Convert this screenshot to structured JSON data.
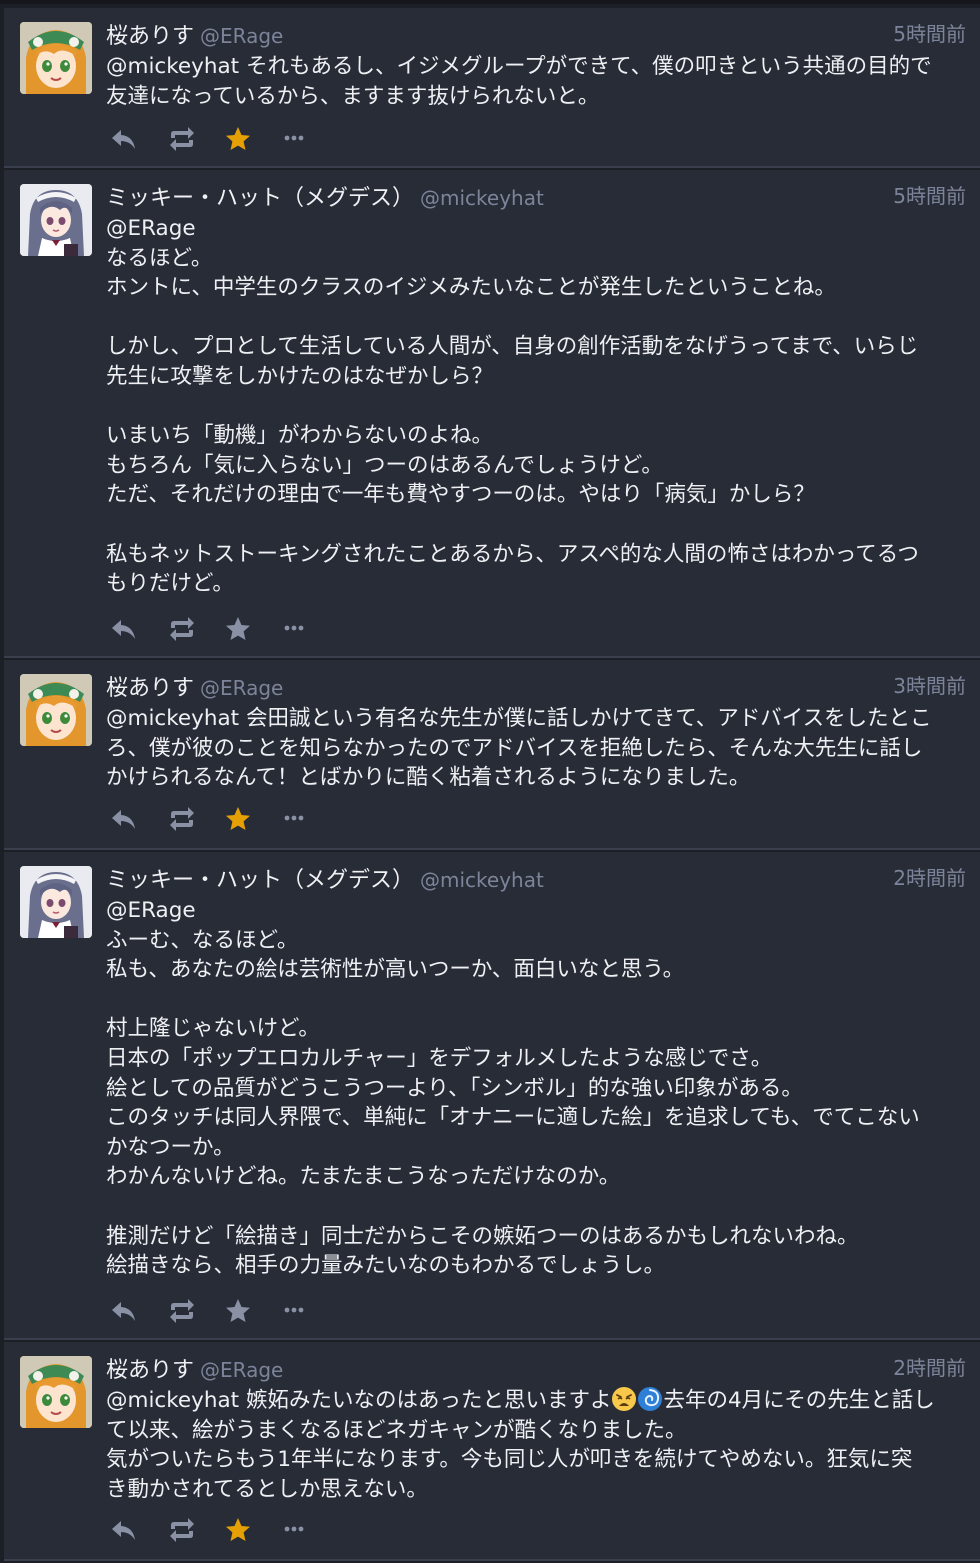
{
  "colors": {
    "background": "#1c1f26",
    "card": "#282c37",
    "muted": "#7d8499",
    "text": "#eef0f3",
    "favourite_active": "#e5a005",
    "icon": "#8a91a5"
  },
  "statuses": [
    {
      "display_name": "桜ありす",
      "acct": "@ERage",
      "time": "5時間前",
      "avatar": "avatar-alice",
      "favourited": true,
      "content": "@mickeyhat それもあるし、イジメグループができて、僕の叩きという共通の目的で\n友達になっているから、ますます抜けられないと。"
    },
    {
      "display_name": "ミッキー・ハット（メグデス）",
      "acct": "@mickeyhat",
      "time": "5時間前",
      "avatar": "avatar-mickey",
      "favourited": false,
      "content": "@ERage\nなるほど。\nホントに、中学生のクラスのイジメみたいなことが発生したということね。\n\nしかし、プロとして生活している人間が、自身の創作活動をなげうってまで、いらじ\n先生に攻撃をしかけたのはなぜかしら？\n\nいまいち「動機」がわからないのよね。\nもちろん「気に入らない」つーのはあるんでしょうけど。\nただ、それだけの理由で一年も費やすつーのは。やはり「病気」かしら？\n\n私もネットストーキングされたことあるから、アスペ的な人間の怖さはわかってるつ\nもりだけど。"
    },
    {
      "display_name": "桜ありす",
      "acct": "@ERage",
      "time": "3時間前",
      "avatar": "avatar-alice",
      "favourited": true,
      "content": "@mickeyhat 会田誠という有名な先生が僕に話しかけてきて、アドバイスをしたとこ\nろ、僕が彼のことを知らなかったのでアドバイスを拒絶したら、そんな大先生に話し\nかけられるなんて！とばかりに酷く粘着されるようになりました。"
    },
    {
      "display_name": "ミッキー・ハット（メグデス）",
      "acct": "@mickeyhat",
      "time": "2時間前",
      "avatar": "avatar-mickey",
      "favourited": false,
      "content": "@ERage\nふーむ、なるほど。\n私も、あなたの絵は芸術性が高いつーか、面白いなと思う。\n\n村上隆じゃないけど。\n日本の「ポップエロカルチャー」をデフォルメしたような感じでさ。\n絵としての品質がどうこうつーより、「シンボル」的な強い印象がある。\nこのタッチは同人界隈で、単純に「オナニーに適した絵」を追求しても、でてこない\nかなつーか。\nわかんないけどね。たまたまこうなっただけなのか。\n\n推測だけど「絵描き」同士だからこその嫉妬つーのはあるかもしれないわね。\n絵描きなら、相手の力量みたいなのもわかるでしょうし。"
    },
    {
      "display_name": "桜ありす",
      "acct": "@ERage",
      "time": "2時間前",
      "avatar": "avatar-alice",
      "favourited": true,
      "content_before_emoji": "@mickeyhat 嫉妬みたいなのはあったと思いますよ",
      "emojis": [
        "weary-face-emoji",
        "cyclone-emoji"
      ],
      "content_after_emoji": "去年の4月にその先生と話し\nて以来、絵がうまくなるほどネガキャンが酷くなりました。\n気がついたらもう1年半になります。今も同じ人が叩きを続けてやめない。狂気に突\nき動かされてるとしか思えない。"
    }
  ]
}
